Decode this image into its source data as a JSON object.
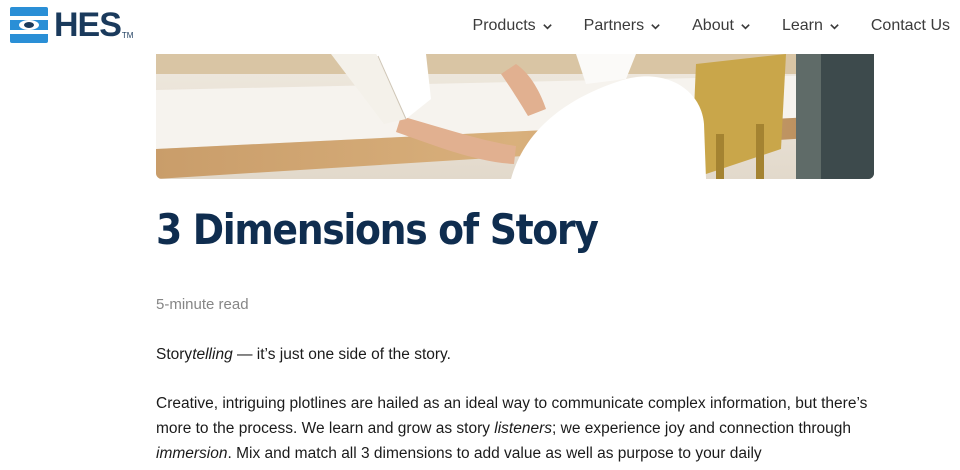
{
  "header": {
    "logo_text": "HES",
    "logo_tm": "TM",
    "nav": [
      {
        "label": "Products",
        "has_dropdown": true
      },
      {
        "label": "Partners",
        "has_dropdown": true
      },
      {
        "label": "About",
        "has_dropdown": true
      },
      {
        "label": "Learn",
        "has_dropdown": true
      },
      {
        "label": "Contact Us",
        "has_dropdown": false
      }
    ]
  },
  "article": {
    "title": "3 Dimensions of Story",
    "read_time": "5-minute read",
    "p1": {
      "a": "Story",
      "b": "telling",
      "c": " — it’s just one side of the story."
    },
    "p2": {
      "a": "Creative, intriguing plotlines are hailed as an ideal way to communicate complex information, but there’s more to the process. We learn and grow as story ",
      "b": "listeners",
      "c": "; we experience joy and connection through ",
      "d": "immersion",
      "e": ". Mix and match all 3 dimensions to add value as well as purpose to your daily"
    }
  },
  "colors": {
    "brand_navy": "#0f2d4f",
    "logo_blue": "#2a8fd6",
    "nav_text": "#3b3b3b",
    "muted_text": "#868686"
  }
}
